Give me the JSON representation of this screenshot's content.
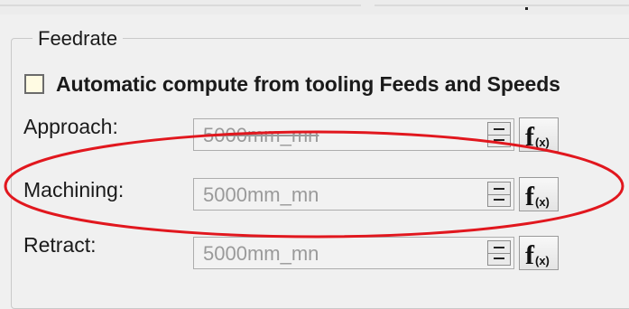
{
  "feedrate": {
    "group_title": "Feedrate",
    "auto_compute": {
      "checked": false,
      "label": "Automatic compute from tooling Feeds and Speeds"
    },
    "fields": [
      {
        "id": "approach",
        "label": "Approach:",
        "value": "5000mm_mn",
        "formula_label": "f(x)"
      },
      {
        "id": "machining",
        "label": "Machining:",
        "value": "5000mm_mn",
        "formula_label": "f(x)"
      },
      {
        "id": "retract",
        "label": "Retract:",
        "value": "5000mm_mn",
        "formula_label": "f(x)"
      }
    ]
  },
  "annotation": {
    "ellipse_color": "#e1171e",
    "highlighted_field": "machining"
  },
  "colors": {
    "background": "#f0f0f0",
    "checkbox_fill": "#fffbe3",
    "disabled_text": "#9a9a9a"
  }
}
